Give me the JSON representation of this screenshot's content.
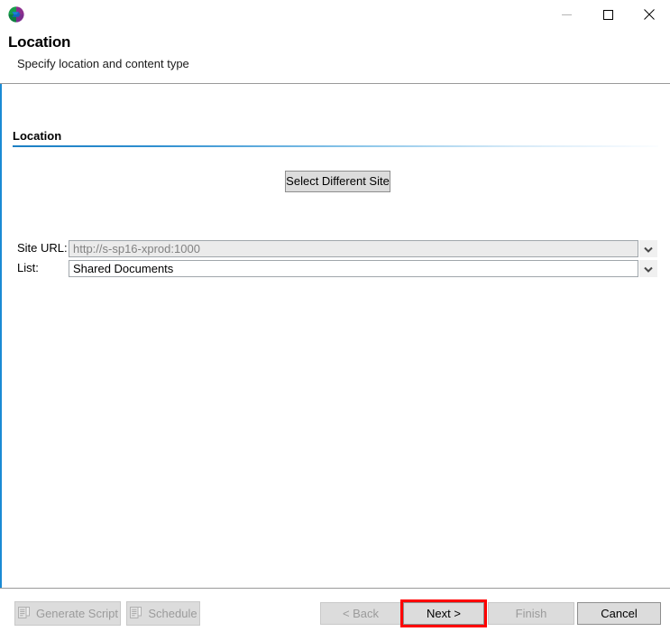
{
  "window": {
    "app_icon": "app-cube-logo-icon",
    "controls": [
      {
        "name": "minimize",
        "glyph": "minimize-icon",
        "enabled": false
      },
      {
        "name": "maximize",
        "glyph": "maximize-icon",
        "enabled": true
      },
      {
        "name": "close",
        "glyph": "close-icon",
        "enabled": true
      }
    ]
  },
  "header": {
    "title": "Location",
    "subtitle": "Specify location and content type"
  },
  "main": {
    "section_label": "Location",
    "select_site_button": "Select Different Site",
    "fields": [
      {
        "label": "Site URL:",
        "value": "http://s-sp16-xprod:1000",
        "placeholder": "",
        "enabled": false,
        "dropdown_icon": "chevron-down-icon"
      },
      {
        "label": "List:",
        "value": "Shared Documents",
        "placeholder": "",
        "enabled": true,
        "dropdown_icon": "chevron-down-icon"
      }
    ]
  },
  "footer": {
    "left_buttons": [
      {
        "label": "Generate Script",
        "icon": "script-document-icon",
        "enabled": false
      },
      {
        "label": "Schedule",
        "icon": "script-document-icon",
        "enabled": false
      }
    ],
    "nav_buttons": [
      {
        "label": "< Back",
        "enabled": false,
        "highlighted": false
      },
      {
        "label": "Next >",
        "enabled": true,
        "highlighted": true
      },
      {
        "label": "Finish",
        "enabled": false,
        "highlighted": false
      },
      {
        "label": "Cancel",
        "enabled": true,
        "highlighted": false
      }
    ]
  },
  "colors": {
    "accent_blue": "#1a8ad4",
    "highlight_red": "#ff0000",
    "button_face": "#dcdcdc",
    "disabled_text": "#9b9b9b",
    "disabled_field_bg": "#ebebeb"
  }
}
